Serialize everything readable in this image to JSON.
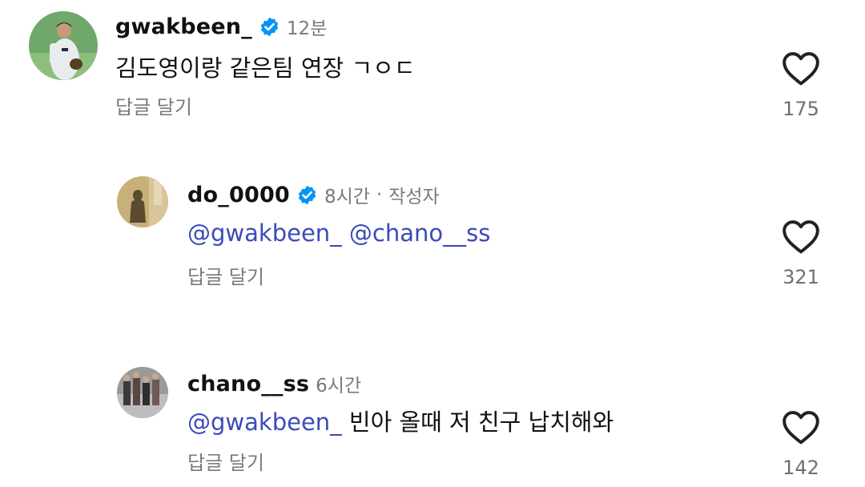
{
  "comments": [
    {
      "username": "gwakbeen_",
      "verified": true,
      "time": "12분",
      "author_tag": "",
      "text": "김도영이랑 같은팀 연장 ㄱㅇㄷ",
      "mentions": [],
      "reply_label": "답글 달기",
      "likes": "175",
      "heart_icon": "heart-outline-icon"
    },
    {
      "username": "do_0000",
      "verified": true,
      "time": "8시간",
      "author_tag": "작성자",
      "text": "",
      "mentions": [
        "@gwakbeen_",
        "@chano__ss"
      ],
      "reply_label": "답글 달기",
      "likes": "321",
      "heart_icon": "heart-outline-icon"
    },
    {
      "username": "chano__ss",
      "verified": false,
      "time": "6시간",
      "author_tag": "",
      "text": "빈아 올때 저 친구 납치해와",
      "mentions": [
        "@gwakbeen_"
      ],
      "reply_label": "답글 달기",
      "likes": "142",
      "heart_icon": "heart-outline-icon"
    }
  ],
  "colors": {
    "mention": "#3a4bb8",
    "verified_badge": "#0095f6",
    "muted_text": "#7a7a7a"
  }
}
